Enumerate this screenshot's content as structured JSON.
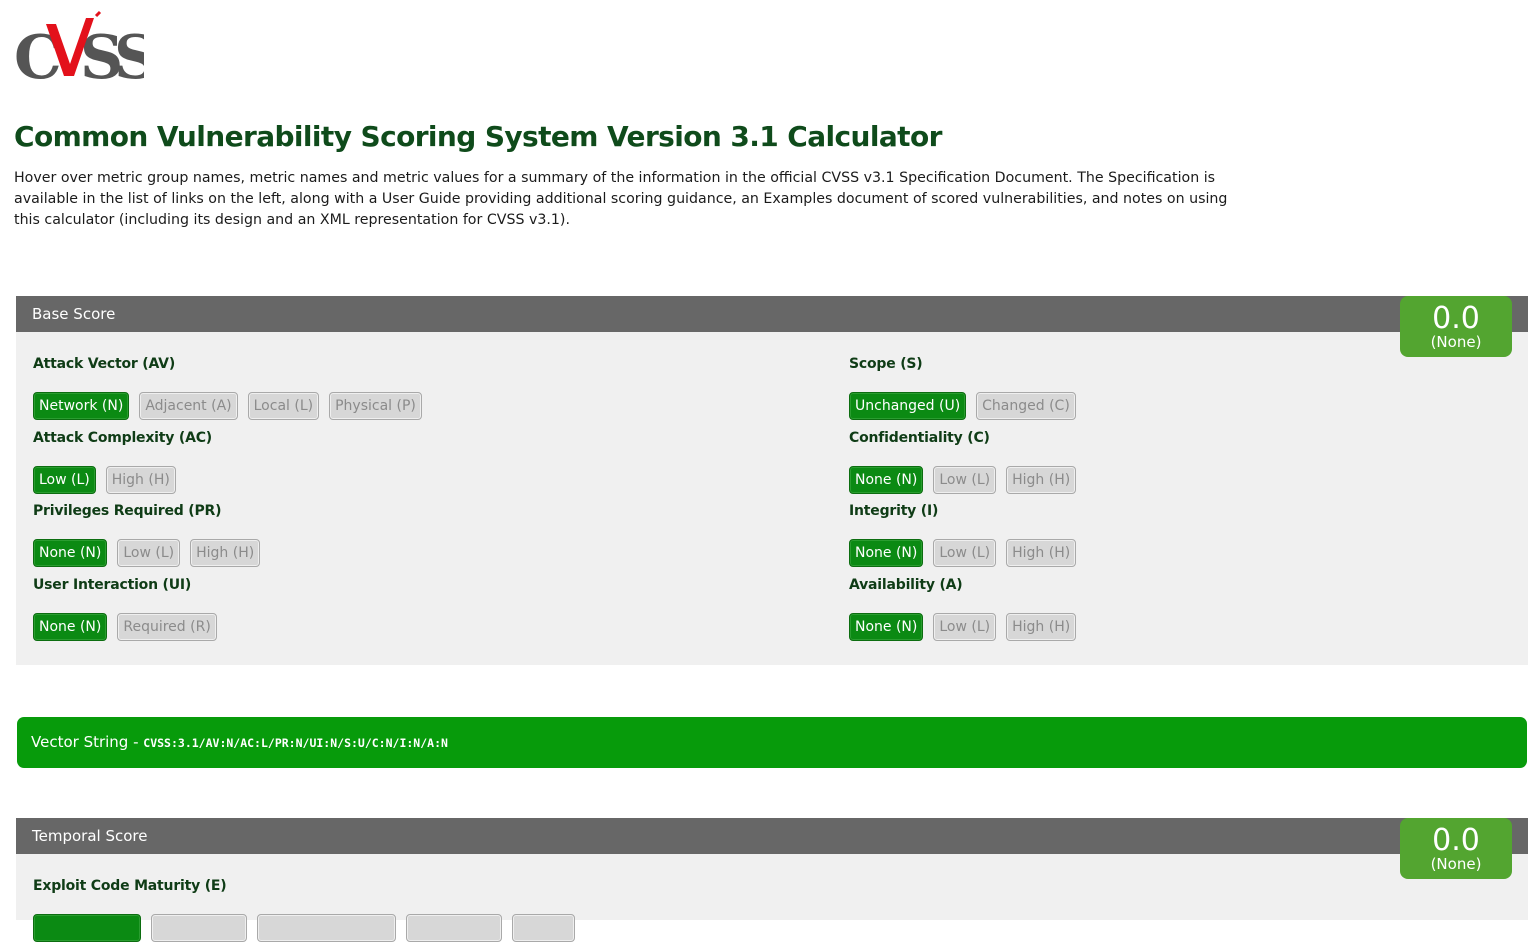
{
  "logo": {
    "text": "CVSS"
  },
  "page": {
    "title": "Common Vulnerability Scoring System Version 3.1 Calculator",
    "intro": "Hover over metric group names, metric names and metric values for a summary of the information in the official CVSS v3.1 Specification Document. The Specification is available in the list of links on the left, along with a User Guide providing additional scoring guidance, an Examples document of scored vulnerabilities, and notes on using this calculator (including its design and an XML representation for CVSS v3.1)."
  },
  "base": {
    "title": "Base Score",
    "score": "0.0",
    "severity": "(None)",
    "metrics": {
      "av": {
        "name": "Attack Vector (AV)",
        "options": [
          "Network (N)",
          "Adjacent (A)",
          "Local (L)",
          "Physical (P)"
        ],
        "selected": 0
      },
      "ac": {
        "name": "Attack Complexity (AC)",
        "options": [
          "Low (L)",
          "High (H)"
        ],
        "selected": 0
      },
      "pr": {
        "name": "Privileges Required (PR)",
        "options": [
          "None (N)",
          "Low (L)",
          "High (H)"
        ],
        "selected": 0
      },
      "ui": {
        "name": "User Interaction (UI)",
        "options": [
          "None (N)",
          "Required (R)"
        ],
        "selected": 0
      },
      "s": {
        "name": "Scope (S)",
        "options": [
          "Unchanged (U)",
          "Changed (C)"
        ],
        "selected": 0
      },
      "c": {
        "name": "Confidentiality (C)",
        "options": [
          "None (N)",
          "Low (L)",
          "High (H)"
        ],
        "selected": 0
      },
      "i": {
        "name": "Integrity (I)",
        "options": [
          "None (N)",
          "Low (L)",
          "High (H)"
        ],
        "selected": 0
      },
      "a": {
        "name": "Availability (A)",
        "options": [
          "None (N)",
          "Low (L)",
          "High (H)"
        ],
        "selected": 0
      }
    }
  },
  "vector": {
    "label": "Vector String - ",
    "value": "CVSS:3.1/AV:N/AC:L/PR:N/UI:N/S:U/C:N/I:N/A:N"
  },
  "temporal": {
    "title": "Temporal Score",
    "score": "0.0",
    "severity": "(None)",
    "metrics": {
      "e": {
        "name": "Exploit Code Maturity (E)"
      }
    }
  },
  "colors": {
    "selected": "#0b8a13",
    "score_box": "#53a530",
    "vector_bar": "#079b0b",
    "header_bar": "#676767",
    "title": "#0f4b1b"
  }
}
